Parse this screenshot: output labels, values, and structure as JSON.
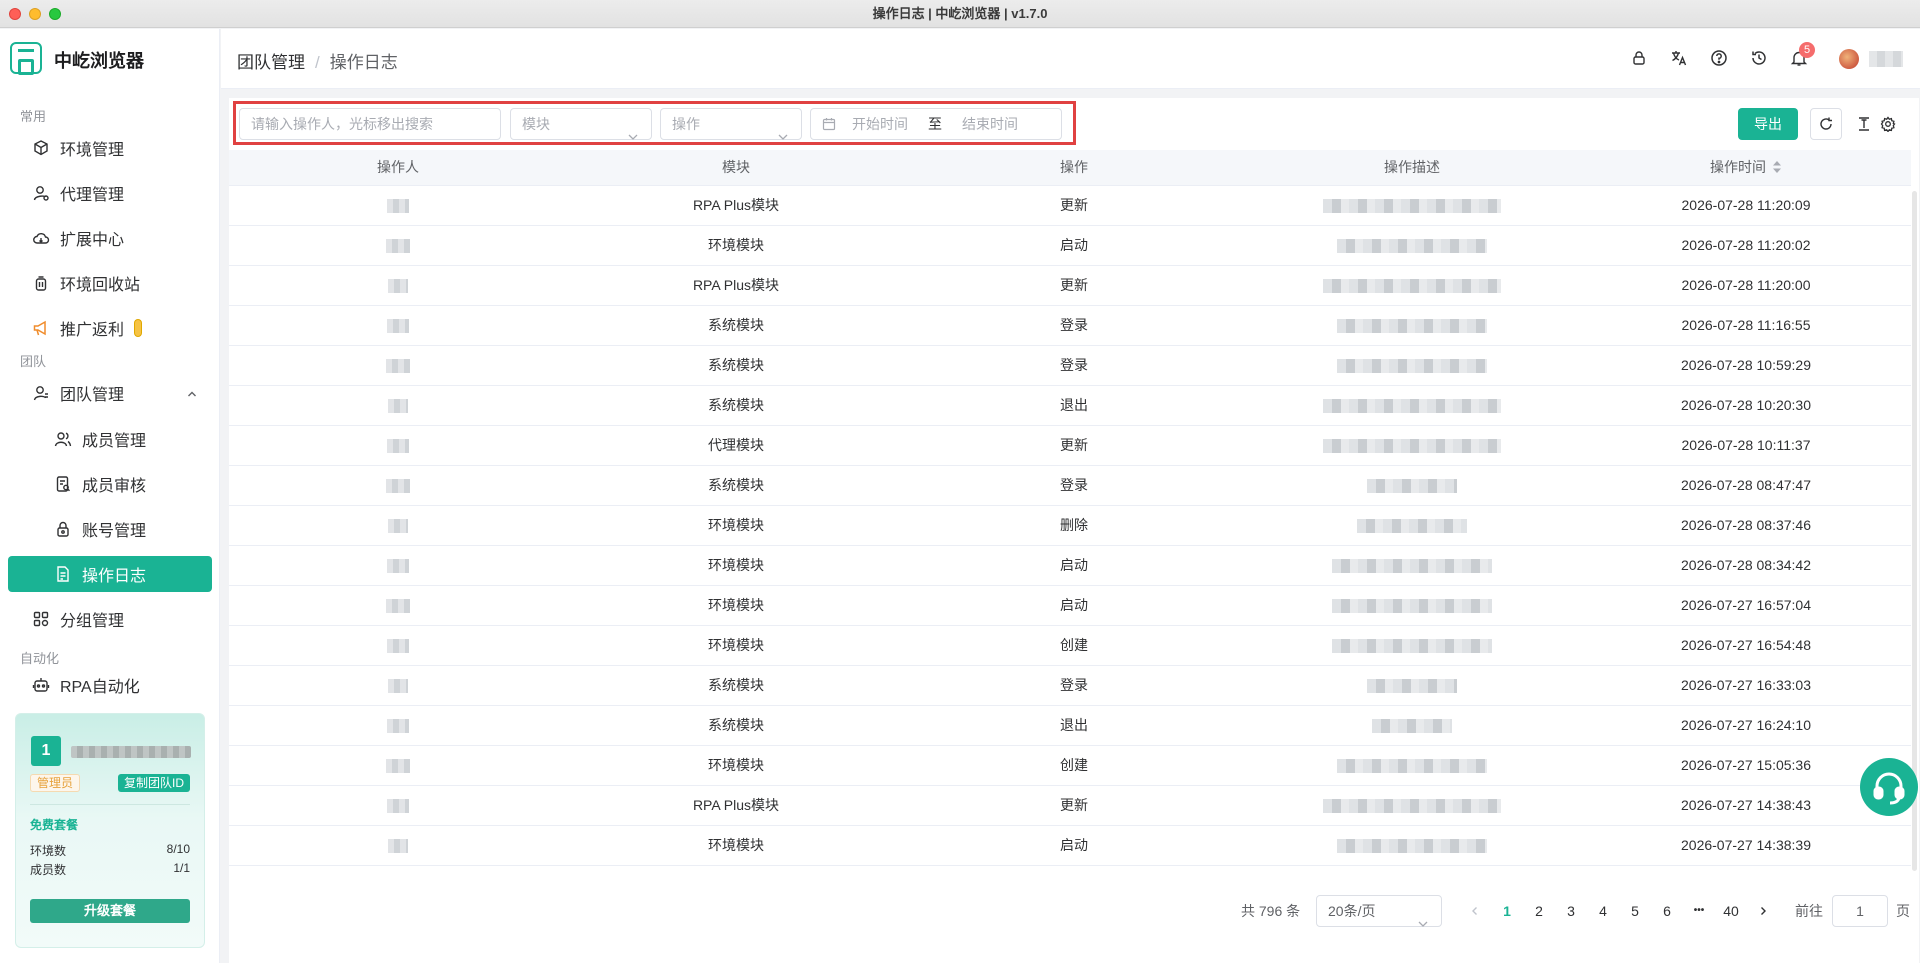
{
  "window": {
    "title": "操作日志 | 中屹浏览器 | v1.7.0"
  },
  "brand": {
    "name": "中屹浏览器"
  },
  "sidebar": {
    "sections": [
      "常用",
      "团队",
      "自动化"
    ],
    "items": [
      {
        "label": "环境管理",
        "icon": "cube-icon"
      },
      {
        "label": "代理管理",
        "icon": "user-proxy-icon"
      },
      {
        "label": "扩展中心",
        "icon": "cloud-icon"
      },
      {
        "label": "环境回收站",
        "icon": "trash-icon"
      },
      {
        "label": "推广返利",
        "icon": "megaphone-icon"
      },
      {
        "label": "团队管理",
        "icon": "team-icon"
      },
      {
        "label": "成员管理",
        "icon": "users-icon"
      },
      {
        "label": "成员审核",
        "icon": "audit-icon"
      },
      {
        "label": "账号管理",
        "icon": "lock-account-icon"
      },
      {
        "label": "操作日志",
        "icon": "log-icon"
      },
      {
        "label": "分组管理",
        "icon": "group-icon"
      },
      {
        "label": "RPA自动化",
        "icon": "robot-icon"
      }
    ]
  },
  "team_card": {
    "number": "1",
    "role": "管理员",
    "copy_id": "复制团队ID",
    "plan": "免费套餐",
    "env_label": "环境数",
    "env_value": "8/10",
    "member_label": "成员数",
    "member_value": "1/1",
    "upgrade": "升级套餐"
  },
  "header": {
    "breadcrumb": [
      "团队管理",
      "操作日志"
    ],
    "notification_count": "5"
  },
  "filters": {
    "search_placeholder": "请输入操作人，光标移出搜索",
    "module_placeholder": "模块",
    "action_placeholder": "操作",
    "start_placeholder": "开始时间",
    "range_sep": "至",
    "end_placeholder": "结束时间",
    "export": "导出"
  },
  "table": {
    "columns": [
      "操作人",
      "模块",
      "操作",
      "操作描述",
      "操作时间"
    ],
    "rows": [
      {
        "module": "RPA Plus模块",
        "action": "更新",
        "time": "2026-07-28 11:20:09"
      },
      {
        "module": "环境模块",
        "action": "启动",
        "time": "2026-07-28 11:20:02"
      },
      {
        "module": "RPA Plus模块",
        "action": "更新",
        "time": "2026-07-28 11:20:00"
      },
      {
        "module": "系统模块",
        "action": "登录",
        "time": "2026-07-28 11:16:55"
      },
      {
        "module": "系统模块",
        "action": "登录",
        "time": "2026-07-28 10:59:29"
      },
      {
        "module": "系统模块",
        "action": "退出",
        "time": "2026-07-28 10:20:30"
      },
      {
        "module": "代理模块",
        "action": "更新",
        "time": "2026-07-28 10:11:37"
      },
      {
        "module": "系统模块",
        "action": "登录",
        "time": "2026-07-28 08:47:47"
      },
      {
        "module": "环境模块",
        "action": "删除",
        "time": "2026-07-28 08:37:46"
      },
      {
        "module": "环境模块",
        "action": "启动",
        "time": "2026-07-28 08:34:42"
      },
      {
        "module": "环境模块",
        "action": "启动",
        "time": "2026-07-27 16:57:04"
      },
      {
        "module": "环境模块",
        "action": "创建",
        "time": "2026-07-27 16:54:48"
      },
      {
        "module": "系统模块",
        "action": "登录",
        "time": "2026-07-27 16:33:03"
      },
      {
        "module": "系统模块",
        "action": "退出",
        "time": "2026-07-27 16:24:10"
      },
      {
        "module": "环境模块",
        "action": "创建",
        "time": "2026-07-27 15:05:36"
      },
      {
        "module": "RPA Plus模块",
        "action": "更新",
        "time": "2026-07-27 14:38:43"
      },
      {
        "module": "环境模块",
        "action": "启动",
        "time": "2026-07-27 14:38:39"
      }
    ]
  },
  "pagination": {
    "total": "共 796 条",
    "page_size": "20条/页",
    "pages": [
      "1",
      "2",
      "3",
      "4",
      "5",
      "6",
      "40"
    ],
    "ellipsis": "•••",
    "current": "1",
    "goto_label": "前往",
    "goto_value": "1",
    "page_suffix": "页"
  }
}
